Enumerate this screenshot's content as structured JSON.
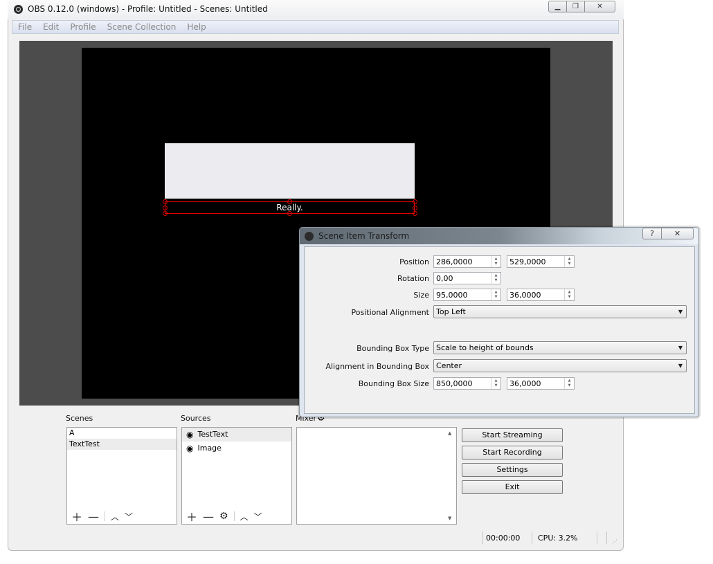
{
  "window": {
    "title": "OBS 0.12.0 (windows) - Profile: Untitled - Scenes: Untitled",
    "controls": [
      "minimize",
      "maximize",
      "close"
    ]
  },
  "menu": [
    "File",
    "Edit",
    "Profile",
    "Scene Collection",
    "Help"
  ],
  "preview": {
    "text_source_content": "Really."
  },
  "scenes": {
    "label": "Scenes",
    "items": [
      "A",
      "TextTest"
    ],
    "selected": "TextTest"
  },
  "sources": {
    "label": "Sources",
    "items": [
      "TestText",
      "Image"
    ],
    "selected": "TestText"
  },
  "mixer": {
    "label": "Mixer"
  },
  "controls": {
    "start_streaming": "Start Streaming",
    "start_recording": "Start Recording",
    "settings": "Settings",
    "exit": "Exit"
  },
  "status": {
    "time": "00:00:00",
    "cpu": "CPU: 3.2%"
  },
  "dialog": {
    "title": "Scene Item Transform",
    "help": "?",
    "labels": {
      "position": "Position",
      "rotation": "Rotation",
      "size": "Size",
      "positional_alignment": "Positional Alignment",
      "bounding_box_type": "Bounding Box Type",
      "alignment_in_bounding_box": "Alignment in Bounding Box",
      "bounding_box_size": "Bounding Box Size"
    },
    "values": {
      "position_x": "286,0000",
      "position_y": "529,0000",
      "rotation": "0,00",
      "size_w": "95,0000",
      "size_h": "36,0000",
      "positional_alignment": "Top Left",
      "bounding_box_type": "Scale to height of bounds",
      "alignment_in_bounding_box": "Center",
      "bbox_w": "850,0000",
      "bbox_h": "36,0000"
    }
  }
}
